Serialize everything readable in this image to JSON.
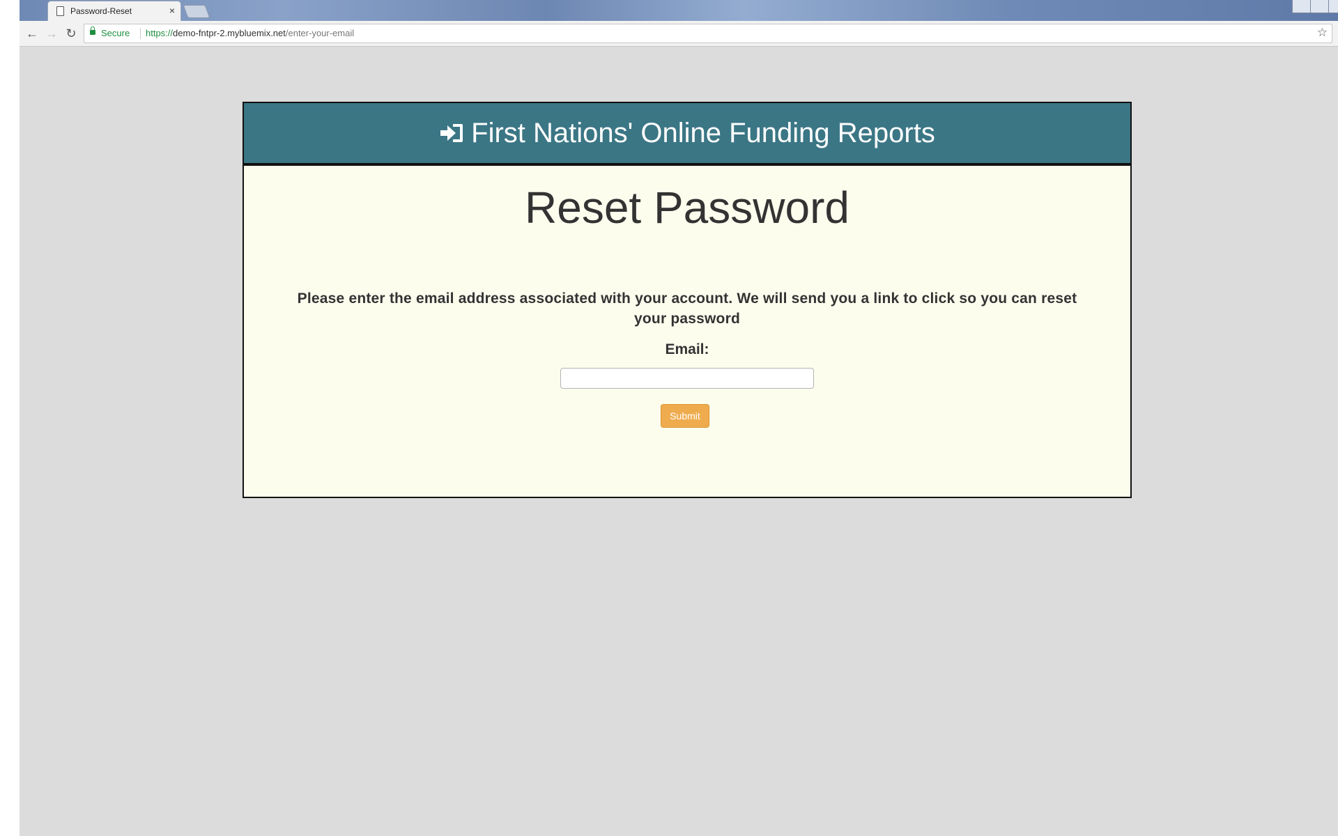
{
  "browser": {
    "tab_title": "Password-Reset",
    "tab_close": "×",
    "security_label": "Secure",
    "url_scheme": "https://",
    "url_host": "demo-fntpr-2.mybluemix.net",
    "url_path": "/enter-your-email",
    "back_glyph": "←",
    "forward_glyph": "→",
    "reload_glyph": "↻",
    "star_glyph": "☆"
  },
  "header": {
    "icon": "sign-in-icon",
    "title": "First Nations' Online Funding Reports"
  },
  "main": {
    "page_title": "Reset Password",
    "instructions": "Please enter the email address associated with your account. We will send you a link to click so you can reset your password",
    "email_label": "Email:",
    "email_value": "",
    "submit_label": "Submit"
  },
  "colors": {
    "header_bg": "#3b7685",
    "card_bg": "#fdfdee",
    "page_bg": "#dcdcdc",
    "button_bg": "#efac4e"
  }
}
